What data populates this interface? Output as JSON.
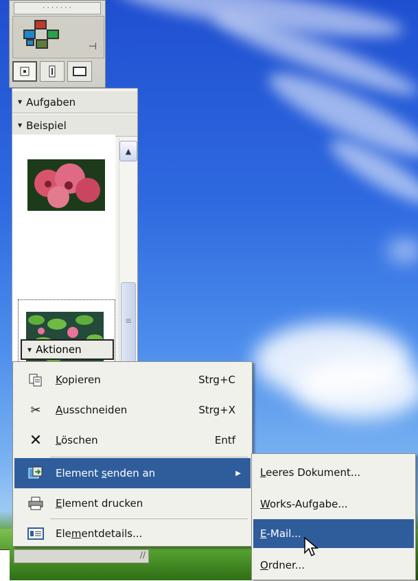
{
  "sidebar": {
    "grip_dots": "·······",
    "pin_glyph": "⊣",
    "view_buttons": [
      "small-view",
      "medium-view",
      "large-view"
    ]
  },
  "panel": {
    "sections": [
      {
        "label": "Aufgaben"
      },
      {
        "label": "Beispiel"
      }
    ],
    "actions_label": "Aktionen"
  },
  "context_menu": {
    "items": [
      {
        "label_pre": "",
        "label_ul": "K",
        "label_post": "opieren",
        "shortcut": "Strg+C",
        "icon": "copy-icon"
      },
      {
        "label_pre": "",
        "label_ul": "A",
        "label_post": "usschneiden",
        "shortcut": "Strg+X",
        "icon": "scissors-icon"
      },
      {
        "label_pre": "",
        "label_ul": "L",
        "label_post": "öschen",
        "shortcut": "Entf",
        "icon": "delete-icon"
      },
      {
        "label_pre": "Element ",
        "label_ul": "s",
        "label_post": "enden an",
        "shortcut": "",
        "icon": "send-to-icon",
        "highlighted": true
      },
      {
        "label_pre": "",
        "label_ul": "E",
        "label_post": "lement drucken",
        "shortcut": "",
        "icon": "printer-icon"
      },
      {
        "label_pre": "Ele",
        "label_ul": "m",
        "label_post": "entdetails...",
        "shortcut": "",
        "icon": "details-icon"
      }
    ]
  },
  "submenu": {
    "items": [
      {
        "label_pre": "",
        "label_ul": "L",
        "label_post": "eeres Dokument..."
      },
      {
        "label_pre": "",
        "label_ul": "W",
        "label_post": "orks-Aufgabe..."
      },
      {
        "label_pre": "",
        "label_ul": "E",
        "label_post": "-Mail...",
        "highlighted": true
      },
      {
        "label_pre": "",
        "label_ul": "O",
        "label_post": "rdner..."
      }
    ]
  },
  "colors": {
    "highlight": "#2f5d9c",
    "menu_bg": "#f1f1ec"
  }
}
